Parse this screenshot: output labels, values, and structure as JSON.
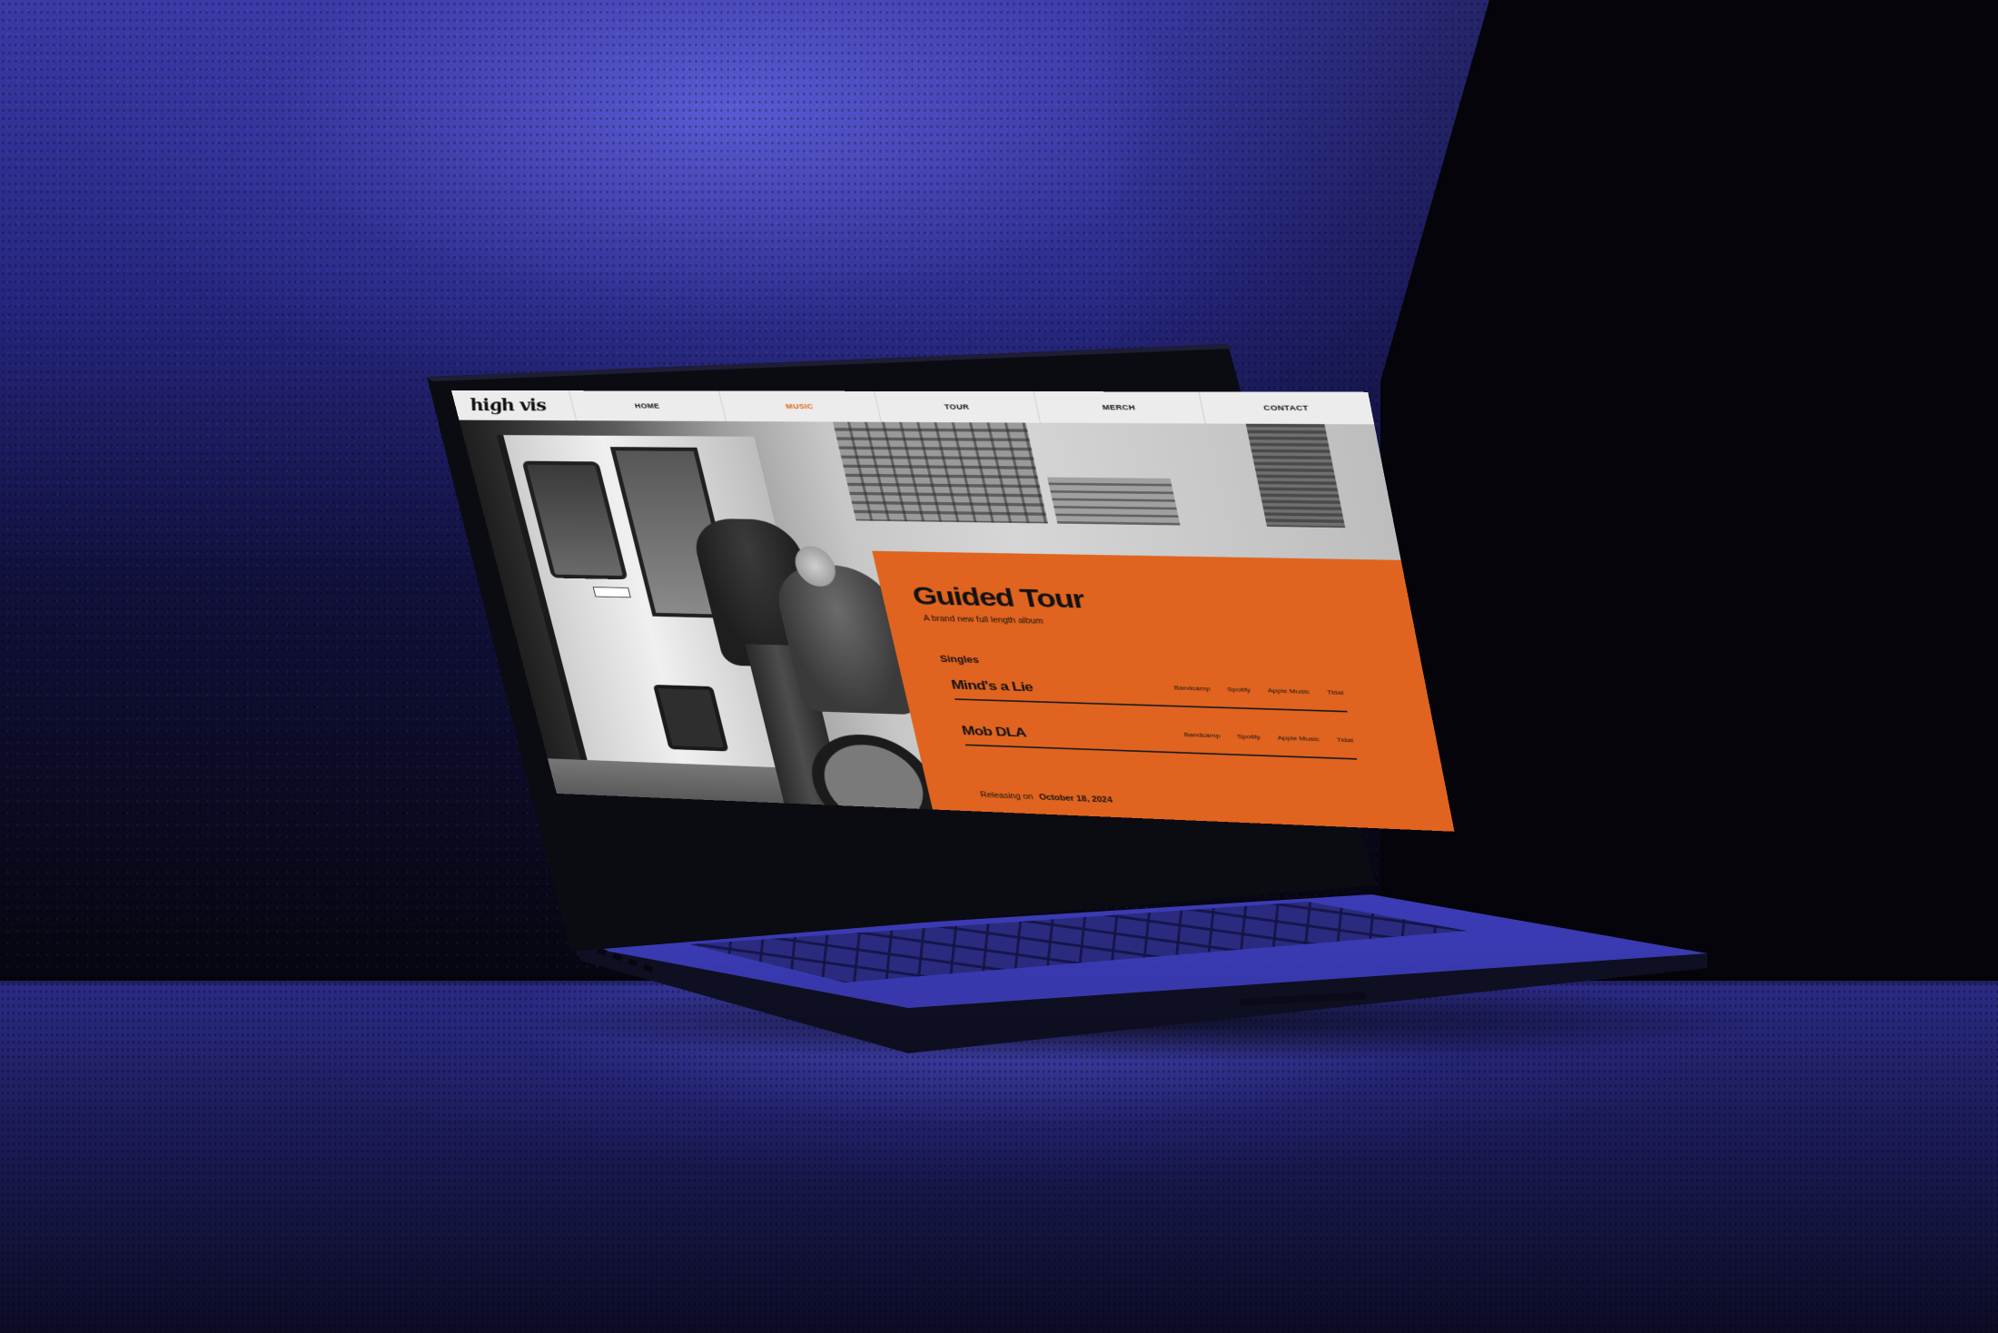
{
  "site": {
    "logo": "high vis",
    "nav": [
      {
        "label": "HOME",
        "active": false
      },
      {
        "label": "MUSIC",
        "active": true
      },
      {
        "label": "TOUR",
        "active": false
      },
      {
        "label": "MERCH",
        "active": false
      },
      {
        "label": "CONTACT",
        "active": false
      }
    ],
    "accent_color": "#e0641f"
  },
  "album": {
    "title": "Guided Tour",
    "subtitle": "A brand new full length album",
    "singles_heading": "Singles",
    "singles": [
      {
        "name": "Mind's a Lie",
        "links": [
          "Bandcamp",
          "Spotify",
          "Apple Music",
          "Tidal"
        ]
      },
      {
        "name": "Mob DLA",
        "links": [
          "Bandcamp",
          "Spotify",
          "Apple Music",
          "Tidal"
        ]
      }
    ],
    "release_prefix": "Releasing on",
    "release_date": "October 18, 2024"
  }
}
